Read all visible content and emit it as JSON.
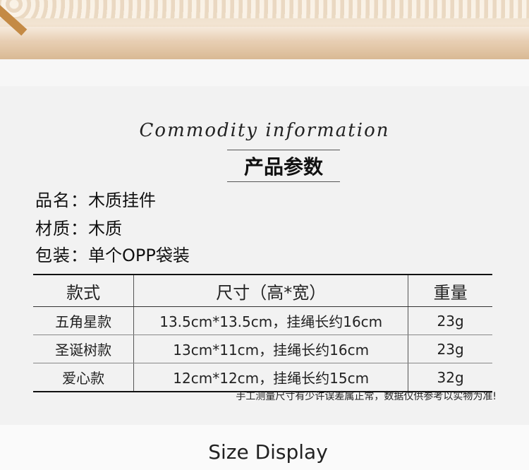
{
  "header": {
    "title_en": "Commodity information",
    "title_cn": "产品参数"
  },
  "specs": [
    {
      "label": "品名：",
      "value": "木质挂件"
    },
    {
      "label": "材质：",
      "value": "木质"
    },
    {
      "label": "包装：",
      "value": "单个OPP袋装"
    }
  ],
  "table": {
    "headers": [
      "款式",
      "尺寸（高*宽）",
      "重量"
    ],
    "rows": [
      [
        "五角星款",
        "13.5cm*13.5cm，挂绳长约16cm",
        "23g"
      ],
      [
        "圣诞树款",
        "13cm*11cm，挂绳长约16cm",
        "23g"
      ],
      [
        "爱心款",
        "12cm*12cm，挂绳长约15cm",
        "32g"
      ]
    ]
  },
  "note": "手工测量尺寸有少许误差属正常，数据仅供参考以实物为准!",
  "next_section": "Size Display"
}
